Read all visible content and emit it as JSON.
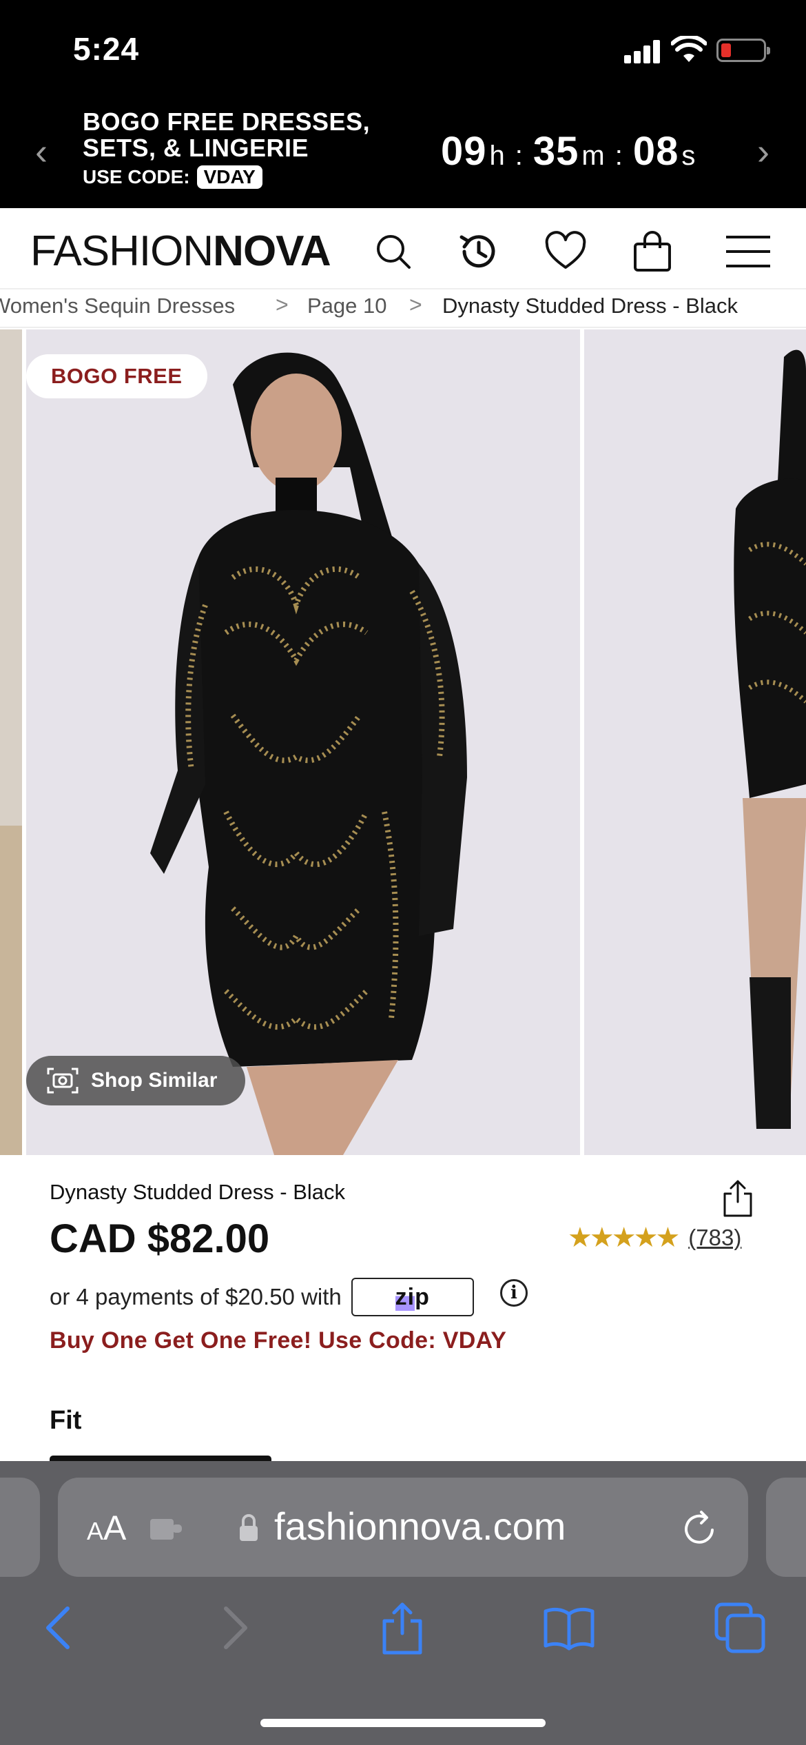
{
  "status_bar": {
    "time": "5:24"
  },
  "promo": {
    "title_line1": "BOGO FREE DRESSES,",
    "title_line2": "SETS, & LINGERIE",
    "code_label": "USE CODE:",
    "code": "VDAY",
    "countdown": {
      "hours": "09",
      "hours_unit": "h",
      "minutes": "35",
      "minutes_unit": "m",
      "seconds": "08",
      "seconds_unit": "s",
      "separator": ":"
    }
  },
  "nav": {
    "logo_thin": "FASHION",
    "logo_bold": "NOVA"
  },
  "breadcrumb": {
    "items": [
      "Women's Sequin Dresses",
      "Page 10",
      "Dynasty Studded Dress - Black"
    ],
    "separator": ">"
  },
  "gallery": {
    "badge": "BOGO FREE",
    "shop_similar": "Shop Similar"
  },
  "product": {
    "name": "Dynasty Studded Dress - Black",
    "price": "CAD $82.00",
    "rating": 4.5,
    "stars": "★★★★★",
    "rating_count": "(783)",
    "installments_text": "or 4 payments of $20.50 with",
    "zip_label_a": "zi",
    "zip_label_b": "p",
    "info_glyph": "i",
    "promo_text": "Buy One Get One Free! Use Code: VDAY",
    "fit_label": "Fit"
  },
  "safari": {
    "text_size_small": "A",
    "text_size_large": "A",
    "url": "fashionnova.com"
  },
  "colors": {
    "accent_red": "#8b1e1e",
    "star_gold": "#d4a11d",
    "toolbar_blue": "#3b82f6"
  }
}
